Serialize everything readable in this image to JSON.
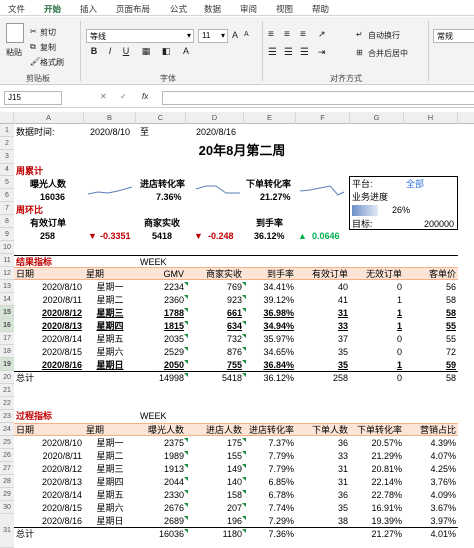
{
  "ribbon": {
    "tabs": [
      "文件",
      "开始",
      "插入",
      "页面布局",
      "公式",
      "数据",
      "审阅",
      "视图",
      "帮助"
    ],
    "active_tab": "开始",
    "paste": "粘贴",
    "cut": "剪切",
    "copy": "复制",
    "format_painter": "格式刷",
    "clipboard_group": "剪贴板",
    "font_name": "等线",
    "font_size": "11",
    "font_group": "字体",
    "bold": "B",
    "italic": "I",
    "underline": "U",
    "wrap_text": "自动换行",
    "merge_center": "合并后居中",
    "align_group": "对齐方式",
    "number_format": "常规",
    "font_grow": "A",
    "font_shrink": "A"
  },
  "formula_bar": {
    "cell_ref": "J15",
    "fx": "fx",
    "content": ""
  },
  "columns": [
    "A",
    "B",
    "C",
    "D",
    "E",
    "F",
    "G",
    "H"
  ],
  "rows": [
    "1",
    "2",
    "3",
    "4",
    "5",
    "6",
    "7",
    "8",
    "9",
    "10",
    "11",
    "12",
    "13",
    "14",
    "15",
    "16",
    "17",
    "18",
    "19",
    "20",
    "21",
    "22",
    "23",
    "24",
    "25",
    "26",
    "27",
    "28",
    "29",
    "30",
    "31"
  ],
  "sheet": {
    "date_label": "数据时间:",
    "date_from": "2020/8/10",
    "date_to_label": "至",
    "date_to": "2020/8/16",
    "title": "20年8月第二周",
    "weekly_label": "周累计",
    "compare_label": "周环比",
    "kpi": {
      "exposure_label": "曝光人数",
      "exposure": "16036",
      "entry_rate_label": "进店转化率",
      "entry_rate": "7.36%",
      "order_rate_label": "下单转化率",
      "order_rate": "21.27%",
      "valid_label": "有效订单",
      "valid": "258",
      "valid_change": "-0.3351",
      "revenue_label": "商家实收",
      "revenue": "5418",
      "revenue_change": "-0.248",
      "arrival_label": "到手率",
      "arrival": "36.12%",
      "arrival_change": "0.0646"
    },
    "platform": {
      "label": "平台:",
      "value": "全部",
      "progress_label": "业务进度",
      "progress": "26%",
      "progress_value": 0.26,
      "target_label": "目标:",
      "target": "200000"
    },
    "result": {
      "section": "结果指标",
      "week_label": "WEEK",
      "headers": [
        "日期",
        "星期",
        "GMV",
        "商家实收",
        "到手率",
        "有效订单",
        "无效订单",
        "客单价"
      ],
      "rows": [
        [
          "2020/8/10",
          "星期一",
          "2234",
          "769",
          "34.41%",
          "40",
          "0",
          "56"
        ],
        [
          "2020/8/11",
          "星期二",
          "2360",
          "923",
          "39.12%",
          "41",
          "1",
          "58"
        ],
        [
          "2020/8/12",
          "星期三",
          "1788",
          "661",
          "36.98%",
          "31",
          "1",
          "58"
        ],
        [
          "2020/8/13",
          "星期四",
          "1815",
          "634",
          "34.94%",
          "33",
          "1",
          "55"
        ],
        [
          "2020/8/14",
          "星期五",
          "2035",
          "732",
          "35.97%",
          "37",
          "0",
          "55"
        ],
        [
          "2020/8/15",
          "星期六",
          "2529",
          "876",
          "34.65%",
          "35",
          "0",
          "72"
        ],
        [
          "2020/8/16",
          "星期日",
          "2050",
          "755",
          "36.84%",
          "35",
          "1",
          "59"
        ]
      ],
      "bold_rows": [
        2,
        3,
        6
      ],
      "total_label": "总计",
      "totals": [
        "14998",
        "5418",
        "36.12%",
        "258",
        "0",
        "58"
      ]
    },
    "process": {
      "section": "过程指标",
      "week_label": "WEEK",
      "headers": [
        "日期",
        "星期",
        "曝光人数",
        "进店人数",
        "进店转化率",
        "下单人数",
        "下单转化率",
        "营销占比"
      ],
      "rows": [
        [
          "2020/8/10",
          "星期一",
          "2375",
          "175",
          "7.37%",
          "36",
          "20.57%",
          "4.39%"
        ],
        [
          "2020/8/11",
          "星期二",
          "1989",
          "155",
          "7.79%",
          "33",
          "21.29%",
          "4.07%"
        ],
        [
          "2020/8/12",
          "星期三",
          "1913",
          "149",
          "7.79%",
          "31",
          "20.81%",
          "4.25%"
        ],
        [
          "2020/8/13",
          "星期四",
          "2044",
          "140",
          "6.85%",
          "31",
          "22.14%",
          "3.76%"
        ],
        [
          "2020/8/14",
          "星期五",
          "2330",
          "158",
          "6.78%",
          "36",
          "22.78%",
          "4.09%"
        ],
        [
          "2020/8/15",
          "星期六",
          "2676",
          "207",
          "7.74%",
          "35",
          "16.91%",
          "3.67%"
        ],
        [
          "2020/8/16",
          "星期日",
          "2689",
          "196",
          "7.29%",
          "38",
          "19.39%",
          "3.97%"
        ]
      ],
      "total_label": "总计",
      "totals": [
        "16036",
        "1180",
        "7.36%",
        "",
        "21.27%",
        "4.01%"
      ]
    }
  },
  "colors": {
    "accent": "#1e6b3c",
    "section_red": "#c00000",
    "header_fill": "#fce4d6",
    "link_blue": "#2e6fd8"
  }
}
